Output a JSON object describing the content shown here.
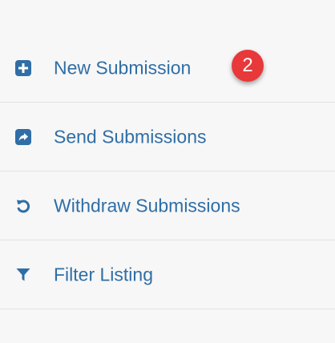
{
  "menu": {
    "items": [
      {
        "label": "New Submission",
        "icon": "plus-square-icon"
      },
      {
        "label": "Send Submissions",
        "icon": "share-square-icon"
      },
      {
        "label": "Withdraw Submissions",
        "icon": "undo-icon"
      },
      {
        "label": "Filter Listing",
        "icon": "filter-icon"
      }
    ]
  },
  "badge": {
    "count": "2",
    "color": "#e8383a"
  },
  "colors": {
    "accent": "#2f6ea6",
    "background": "#f7f7f7",
    "divider": "#e3e3e3"
  }
}
